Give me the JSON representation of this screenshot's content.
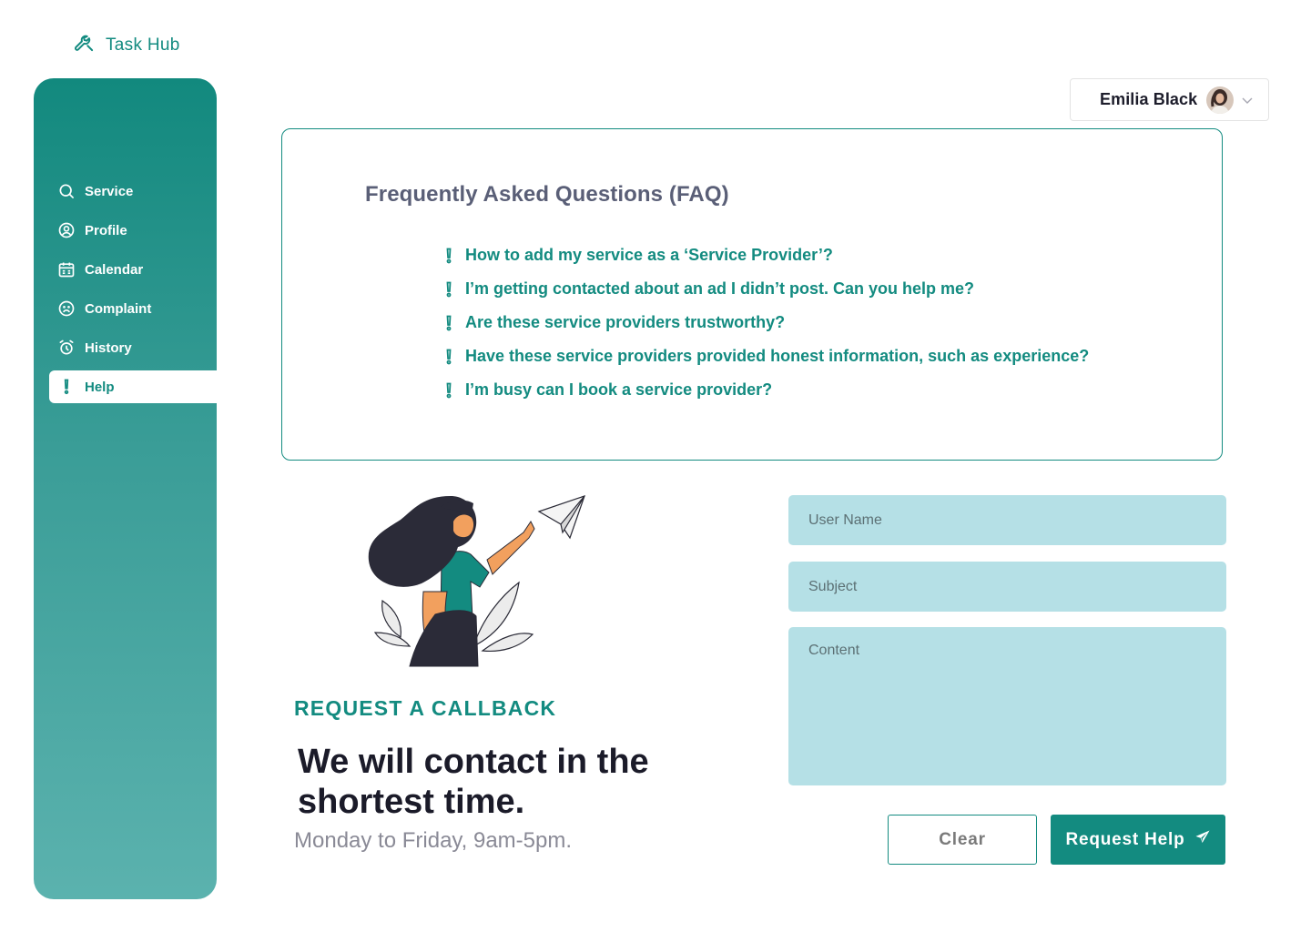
{
  "brand": {
    "name": "Task Hub",
    "icon": "wrench-icon"
  },
  "sidebar": {
    "items": [
      {
        "label": "Service",
        "icon": "search-icon",
        "active": false
      },
      {
        "label": "Profile",
        "icon": "user-circle-icon",
        "active": false
      },
      {
        "label": "Calendar",
        "icon": "calendar-icon",
        "active": false
      },
      {
        "label": "Complaint",
        "icon": "sad-face-icon",
        "active": false
      },
      {
        "label": "History",
        "icon": "alarm-clock-icon",
        "active": false
      },
      {
        "label": "Help",
        "icon": "exclamation-icon",
        "active": true
      }
    ]
  },
  "user": {
    "name": "Emilia Black",
    "avatar": "avatar",
    "menu_icon": "chevron-down-icon"
  },
  "faq": {
    "title": "Frequently Asked Questions  (FAQ)",
    "questions": [
      "How to add my service as a ‘Service Provider’?",
      "I’m getting contacted about an ad I didn’t post. Can you help me?",
      "Are these service providers trustworthy?",
      "Have these service providers provided honest information, such as experience?",
      "I’m busy can I book a service provider?"
    ]
  },
  "callback": {
    "eyebrow": "REQUEST A CALLBACK",
    "heading": "We will contact in the shortest time.",
    "hours": "Monday to Friday, 9am-5pm."
  },
  "form": {
    "username_placeholder": "User Name",
    "subject_placeholder": "Subject",
    "content_placeholder": "Content",
    "clear_label": "Clear",
    "submit_label": "Request Help"
  },
  "colors": {
    "accent": "#138b80",
    "field_bg": "#b5e0e6",
    "heading": "#1b1b29"
  }
}
